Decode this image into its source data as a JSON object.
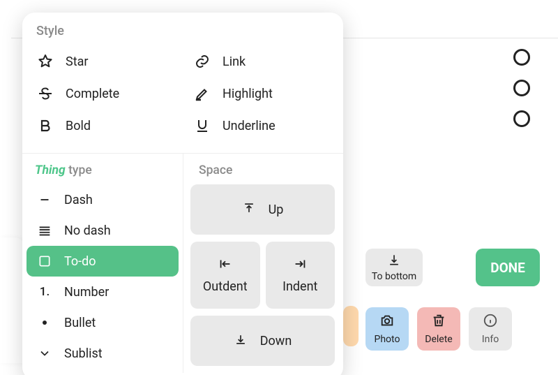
{
  "sections": {
    "style": "Style",
    "thing_prefix": "Thing",
    "thing_suffix": " type",
    "space": "Space"
  },
  "style_items": {
    "star": "Star",
    "complete": "Complete",
    "bold": "Bold",
    "link": "Link",
    "highlight": "Highlight",
    "underline": "Underline"
  },
  "thing_items": {
    "dash": "Dash",
    "nodash": "No dash",
    "todo": "To-do",
    "number": "Number",
    "number_prefix": "1.",
    "bullet": "Bullet",
    "sublist": "Sublist"
  },
  "space_buttons": {
    "up": "Up",
    "outdent": "Outdent",
    "indent": "Indent",
    "down": "Down"
  },
  "toolbar": {
    "done": "DONE",
    "to_bottom": "To bottom",
    "photo": "Photo",
    "delete": "Delete",
    "info": "Info"
  }
}
